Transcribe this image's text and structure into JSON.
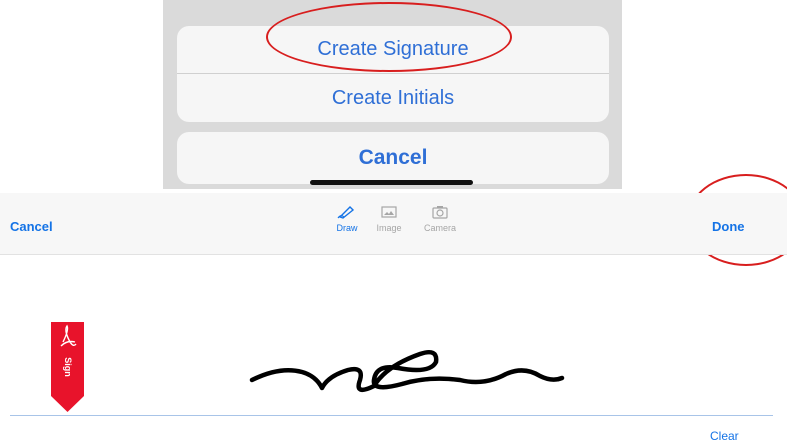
{
  "action_sheet": {
    "options": [
      {
        "label": "Create Signature"
      },
      {
        "label": "Create Initials"
      }
    ],
    "cancel_label": "Cancel"
  },
  "toolbar": {
    "cancel_label": "Cancel",
    "done_label": "Done",
    "modes": [
      {
        "label": "Draw",
        "icon": "pen-icon",
        "active": true
      },
      {
        "label": "Image",
        "icon": "image-icon",
        "active": false
      },
      {
        "label": "Camera",
        "icon": "camera-icon",
        "active": false
      }
    ]
  },
  "canvas": {
    "sign_tag_label": "Sign",
    "clear_label": "Clear"
  },
  "colors": {
    "ios_blue": "#2f6fd6",
    "acrobat_blue": "#1473e6",
    "annotation_red": "#d81e1e",
    "sign_tag_red": "#e8132b"
  }
}
